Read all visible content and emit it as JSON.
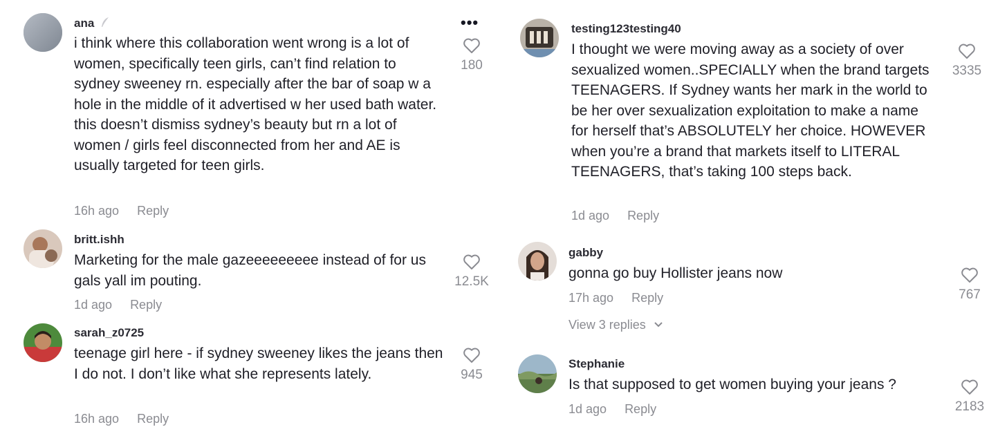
{
  "left_column": [
    {
      "username": "ana",
      "text": "i think where this collaboration went wrong is a lot of women, specifically teen girls, can’t find relation to sydney sweeney rn. especially after the bar of soap w a hole in the middle of it advertised w her used bath water. this doesn’t dismiss sydney’s beauty but rn a lot of women / girls feel disconnected from her and AE is usually targeted for teen girls.",
      "time": "16h ago",
      "reply": "Reply",
      "likes": "180",
      "more_icon": "•••"
    },
    {
      "username": "britt.ishh",
      "text": "Marketing for the male gazeeeeeeeee instead of for us gals yall im pouting.",
      "time": "1d ago",
      "reply": "Reply",
      "likes": "12.5K"
    },
    {
      "username": "sarah_z0725",
      "text": "teenage girl here - if sydney sweeney likes the jeans then I do not. I don’t like what she represents lately.",
      "time": "16h ago",
      "reply": "Reply",
      "likes": "945"
    }
  ],
  "right_column": [
    {
      "username": "testing123testing40",
      "text": "I thought we were moving away as a society of over sexualized women..SPECIALLY when the brand targets TEENAGERS. If Sydney wants her mark in the world to be her over sexualization exploitation to make a name for herself that’s ABSOLUTELY her choice. HOWEVER when you’re a brand that markets itself to LITERAL TEENAGERS, that’s taking 100 steps back.",
      "time": "1d ago",
      "reply": "Reply",
      "likes": "3335"
    },
    {
      "username": "gabby",
      "text": "gonna go buy Hollister jeans now",
      "time": "17h ago",
      "reply": "Reply",
      "likes": "767",
      "view_replies": "View 3 replies"
    },
    {
      "username": "Stephanie",
      "text": "Is that supposed to get women buying your jeans ?",
      "time": "1d ago",
      "reply": "Reply",
      "likes": "2183"
    }
  ],
  "colors": {
    "text": "#1f1f27",
    "muted": "#8a8b91",
    "background": "#ffffff"
  },
  "icons": {
    "like": "heart-outline-icon",
    "more": "more-options-icon",
    "expand": "chevron-down-icon"
  }
}
